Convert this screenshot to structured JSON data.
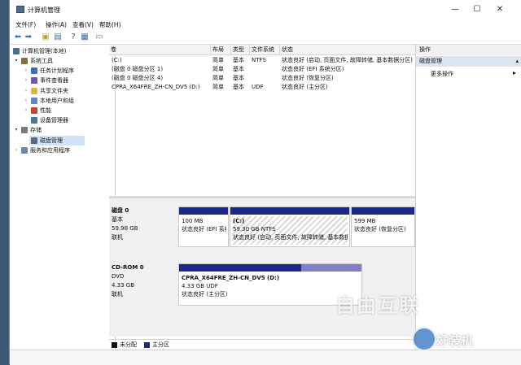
{
  "window": {
    "title": "计算机管理",
    "controls": {
      "minimize": "—",
      "maximize": "☐",
      "close": "✕"
    }
  },
  "menubar": [
    "文件(F)",
    "操作(A)",
    "查看(V)",
    "帮助(H)"
  ],
  "tree": {
    "root": "计算机管理(本地)",
    "items": [
      {
        "label": "系统工具",
        "level": 1,
        "expander": "▾",
        "icon": "tools-icon",
        "color": "#8a6d3b"
      },
      {
        "label": "任务计划程序",
        "level": 2,
        "expander": "›",
        "icon": "clock-icon",
        "color": "#3b6fb0"
      },
      {
        "label": "事件查看器",
        "level": 2,
        "expander": "›",
        "icon": "event-viewer-icon",
        "color": "#6a5aa8"
      },
      {
        "label": "共享文件夹",
        "level": 2,
        "expander": "›",
        "icon": "shared-folder-icon",
        "color": "#d8b24a"
      },
      {
        "label": "本地用户和组",
        "level": 2,
        "expander": "›",
        "icon": "users-icon",
        "color": "#5a8ac0"
      },
      {
        "label": "性能",
        "level": 2,
        "expander": "›",
        "icon": "performance-icon",
        "color": "#c04a3a"
      },
      {
        "label": "设备管理器",
        "level": 2,
        "expander": "",
        "icon": "device-manager-icon",
        "color": "#4a7a9a"
      },
      {
        "label": "存储",
        "level": 1,
        "expander": "▾",
        "icon": "storage-icon",
        "color": "#7a7a7a"
      },
      {
        "label": "磁盘管理",
        "level": 2,
        "expander": "",
        "icon": "disk-icon",
        "color": "#5a6a7a",
        "selected": true
      },
      {
        "label": "服务和应用程序",
        "level": 1,
        "expander": "›",
        "icon": "services-icon",
        "color": "#6a8aa8"
      }
    ]
  },
  "volumes": {
    "headers": [
      "卷",
      "布局",
      "类型",
      "文件系统",
      "状态"
    ],
    "rows": [
      [
        "(C:)",
        "简单",
        "基本",
        "NTFS",
        "状态良好 (启动, 页面文件, 故障转储, 基本数据分区)"
      ],
      [
        "(磁盘 0 磁盘分区 1)",
        "简单",
        "基本",
        "",
        "状态良好 (EFI 系统分区)"
      ],
      [
        "(磁盘 0 磁盘分区 4)",
        "简单",
        "基本",
        "",
        "状态良好 (恢复分区)"
      ],
      [
        "CPRA_X64FRE_ZH-CN_DV5 (D:)",
        "简单",
        "基本",
        "UDF",
        "状态良好 (主分区)"
      ]
    ]
  },
  "disks": [
    {
      "name": "磁盘 0",
      "type": "基本",
      "size": "59.98 GB",
      "status": "联机",
      "partitions": [
        {
          "title": "",
          "line1": "100 MB",
          "line2": "状态良好 (EFI 系统分区)"
        },
        {
          "title": "(C:)",
          "line1": "59.30 GB NTFS",
          "line2": "状态良好 (启动, 页面文件, 故障转储, 基本数据分区)"
        },
        {
          "title": "",
          "line1": "599 MB",
          "line2": "状态良好 (恢复分区)"
        }
      ]
    },
    {
      "name": "CD-ROM 0",
      "type": "DVD",
      "size": "4.33 GB",
      "status": "联机",
      "partitions": [
        {
          "title": "CPRA_X64FRE_ZH-CN_DV5 (D:)",
          "line1": "4.33 GB UDF",
          "line2": "状态良好 (主分区)"
        }
      ]
    }
  ],
  "legend": [
    {
      "label": "未分配",
      "color": "#111111"
    },
    {
      "label": "主分区",
      "color": "#1a2a8a"
    }
  ],
  "actions": {
    "header": "操作",
    "section": "磁盘管理",
    "more": "更多操作",
    "more_arrow": "▸"
  },
  "watermarks": {
    "brand1": "自由互联",
    "brand2": "好装机"
  },
  "colors": {
    "partition_bar": "#1a2a8a",
    "partition_bar_light": "#8080c8",
    "selection": "#cfe3f7"
  }
}
